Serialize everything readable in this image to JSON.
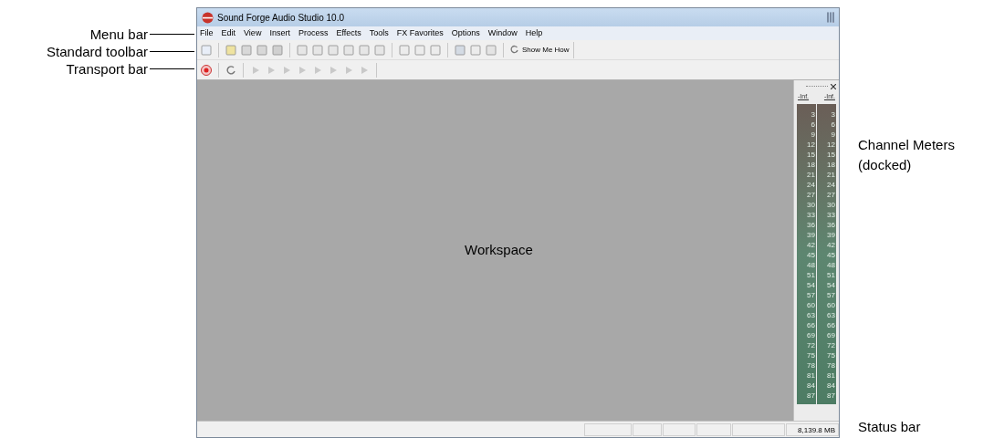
{
  "callouts_left": [
    "Menu bar",
    "Standard toolbar",
    "Transport bar"
  ],
  "window": {
    "title": "Sound Forge Audio Studio 10.0"
  },
  "menu_bar": [
    "File",
    "Edit",
    "View",
    "Insert",
    "Process",
    "Effects",
    "Tools",
    "FX Favorites",
    "Options",
    "Window",
    "Help"
  ],
  "standard_toolbar": {
    "show_me_how": "Show Me How"
  },
  "workspace": {
    "label": "Workspace"
  },
  "channel_meters": {
    "channels": [
      {
        "peak": "-Inf.",
        "scale": [
          "3",
          "6",
          "9",
          "12",
          "15",
          "18",
          "21",
          "24",
          "27",
          "30",
          "33",
          "36",
          "39",
          "42",
          "45",
          "48",
          "51",
          "54",
          "57",
          "60",
          "63",
          "66",
          "69",
          "72",
          "75",
          "78",
          "81",
          "84",
          "87"
        ]
      },
      {
        "peak": "-Inf.",
        "scale": [
          "3",
          "6",
          "9",
          "12",
          "15",
          "18",
          "21",
          "24",
          "27",
          "30",
          "33",
          "36",
          "39",
          "42",
          "45",
          "48",
          "51",
          "54",
          "57",
          "60",
          "63",
          "66",
          "69",
          "72",
          "75",
          "78",
          "81",
          "84",
          "87"
        ]
      }
    ]
  },
  "status_bar": {
    "memory": "8,139.8 MB"
  },
  "callouts_right": [
    {
      "kind": "meters",
      "lines": [
        "Channel Meters",
        "(docked)"
      ]
    },
    {
      "kind": "status",
      "lines": [
        "Status bar"
      ]
    }
  ]
}
